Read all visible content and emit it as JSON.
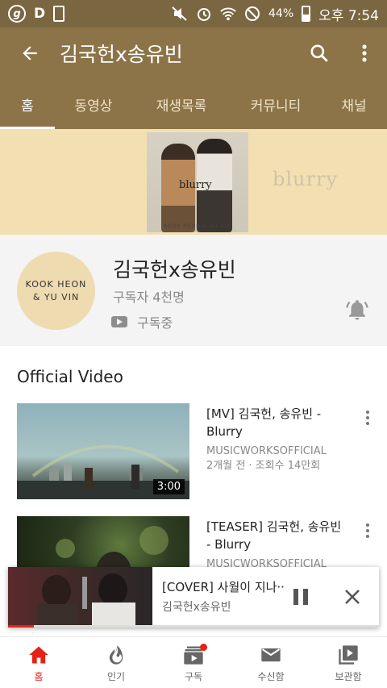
{
  "status_bar": {
    "left_icons": [
      "g-circle-icon",
      "d-icon",
      "recycle-box-icon"
    ],
    "right_icons": [
      "mute-icon",
      "alarm-icon",
      "wifi-icon",
      "block-icon",
      "battery-icon"
    ],
    "battery": "44%",
    "time": "오후 7:54"
  },
  "app_bar": {
    "title": "김국헌x송유빈",
    "color": "#8c7448"
  },
  "tabs": [
    {
      "label": "홈",
      "active": true
    },
    {
      "label": "동영상"
    },
    {
      "label": "재생목록"
    },
    {
      "label": "커뮤니티"
    },
    {
      "label": "채널"
    }
  ],
  "banner": {
    "album_title": "blurry",
    "album_subtitle": "KOOK HEON & YU VIN",
    "word": "blurry",
    "background": "#f2e0b2"
  },
  "channel": {
    "avatar_line1": "KOOK HEON",
    "avatar_line2": "& YU VIN",
    "name": "김국헌x송유빈",
    "subscribers": "구독자 4천명",
    "subscribed_label": "구독중"
  },
  "section_title": "Official Video",
  "videos": [
    {
      "title": "[MV] 김국헌, 송유빈 - Blurry",
      "channel": "MUSICWORKSOFFICIAL",
      "meta": "2개월 전  ·  조회수 14만회",
      "duration": "3:00"
    },
    {
      "title": "[TEASER] 김국헌, 송유빈 - Blurry",
      "channel": "MUSICWORKSOFFICIAL"
    }
  ],
  "mini_player": {
    "title": "[COVER] 사월이 지나··",
    "channel": "김국헌x송유빈",
    "progress": 0.07
  },
  "bottom_nav": [
    {
      "label": "홈",
      "icon": "home-icon",
      "active": true
    },
    {
      "label": "인기",
      "icon": "flame-icon"
    },
    {
      "label": "구독",
      "icon": "subscriptions-icon",
      "badge": true
    },
    {
      "label": "수신함",
      "icon": "mail-icon"
    },
    {
      "label": "보관함",
      "icon": "library-icon"
    }
  ]
}
